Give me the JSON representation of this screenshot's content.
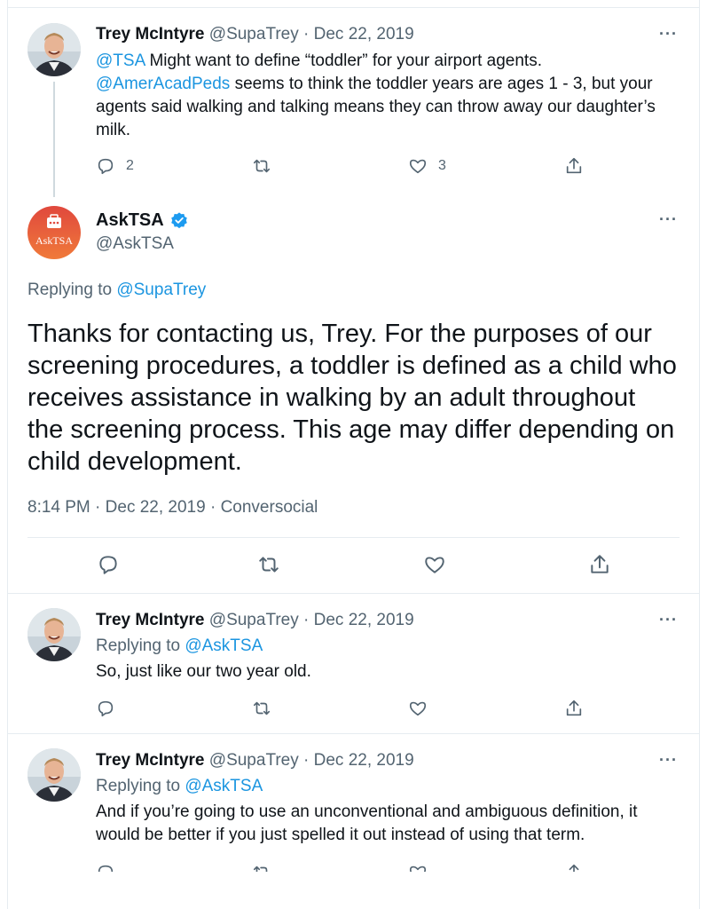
{
  "tweets": [
    {
      "name": "Trey McIntyre",
      "handle": "@SupaTrey",
      "date": "Dec 22, 2019",
      "body_mention1": "@TSA",
      "body_line1_rest": " Might want to define “toddler” for your airport agents.",
      "body_mention2": "@AmerAcadPeds",
      "body_rest": " seems to think the toddler years are ages 1 - 3, but your agents said walking and talking means they can throw away our daughter’s milk.",
      "reply_count": "2",
      "retweet_count": "",
      "like_count": "3"
    }
  ],
  "main_tweet": {
    "avatar_label": "AskTSA",
    "name": "AskTSA",
    "handle": "@AskTSA",
    "replying_prefix": "Replying to",
    "replying_to": "@SupaTrey",
    "text": "Thanks for contacting us, Trey. For the purposes of our screening procedures, a toddler is defined as a child who receives assistance in walking by an adult throughout the screening process. This age may differ depending on child development.",
    "time": "8:14 PM",
    "date": "Dec 22, 2019",
    "source": "Conversocial"
  },
  "replies": [
    {
      "name": "Trey McIntyre",
      "handle": "@SupaTrey",
      "date": "Dec 22, 2019",
      "replying_prefix": "Replying to",
      "replying_to": "@AskTSA",
      "text": "So, just like our two year old."
    },
    {
      "name": "Trey McIntyre",
      "handle": "@SupaTrey",
      "date": "Dec 22, 2019",
      "replying_prefix": "Replying to",
      "replying_to": "@AskTSA",
      "text": "And if you’re going to use an unconventional and ambiguous definition, it would be better if you just spelled it out instead of using that term."
    }
  ],
  "separator": "·",
  "more_label": "···",
  "colors": {
    "link": "#1b95e0",
    "muted": "#536471",
    "border": "#e6ecf0",
    "asktsa_gradient_top": "#e0483d",
    "asktsa_gradient_bottom": "#f07a3a",
    "verified": "#1d9bf0"
  },
  "icons": [
    "reply-icon",
    "retweet-icon",
    "like-icon",
    "share-icon",
    "more-icon",
    "verified-icon"
  ]
}
